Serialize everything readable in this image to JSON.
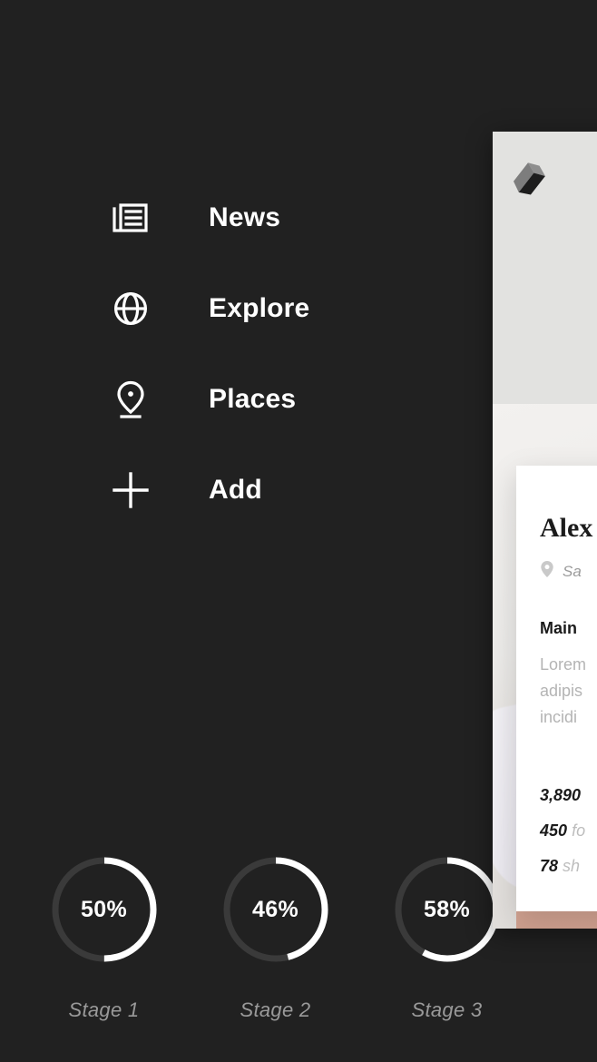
{
  "theme": {
    "background": "#212121",
    "nav_text": "#ffffff",
    "ring_track": "#3a3a3a",
    "ring_fill": "#ffffff",
    "stage_label": "#9a9a9a",
    "panel_background": "#e2e2e0",
    "card_background": "#ffffff",
    "muted_text": "#b4b4b4"
  },
  "nav": {
    "items": [
      {
        "label": "News",
        "icon": "newspaper-icon"
      },
      {
        "label": "Explore",
        "icon": "globe-icon"
      },
      {
        "label": "Places",
        "icon": "map-pin-icon"
      },
      {
        "label": "Add",
        "icon": "plus-icon"
      }
    ]
  },
  "stages": [
    {
      "label": "Stage 1",
      "value": "50%",
      "percent": 50
    },
    {
      "label": "Stage 2",
      "value": "46%",
      "percent": 46
    },
    {
      "label": "Stage 3",
      "value": "58%",
      "percent": 58
    }
  ],
  "preview": {
    "logo": "cube-logo",
    "card": {
      "title": "Alex",
      "location_icon": "map-pin-icon",
      "location": "Sa",
      "section_title": "Main",
      "body_lines": [
        "Lorem",
        "adipis",
        "incidi"
      ],
      "stats": [
        {
          "number": "3,890",
          "word": ""
        },
        {
          "number": "450",
          "word": "fo"
        },
        {
          "number": "78",
          "word": "sh"
        }
      ]
    }
  }
}
